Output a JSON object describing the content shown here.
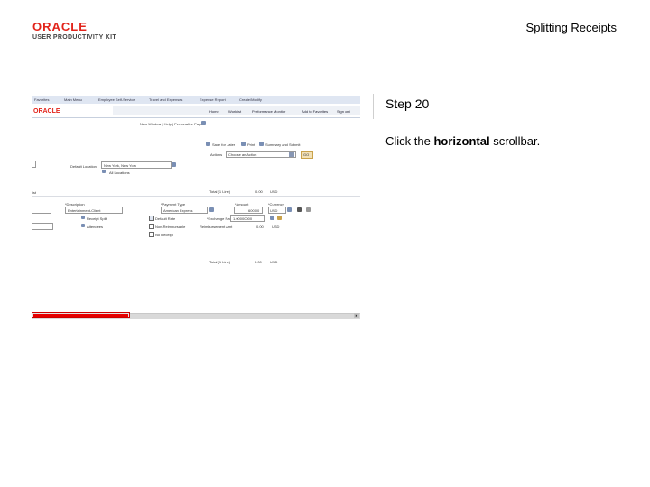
{
  "header": {
    "logo_brand": "ORACLE",
    "logo_product": "USER PRODUCTIVITY KIT",
    "document_title": "Splitting Receipts"
  },
  "instruction_pane": {
    "step": "Step 20",
    "instruction_prefix": "Click the ",
    "instruction_bold": "horizontal",
    "instruction_suffix": " scrollbar."
  },
  "app": {
    "nav": [
      "Favorites",
      "Main Menu",
      "Employee Self-Service",
      "Travel and Expenses",
      "Expense Report",
      "Create/Modify"
    ],
    "brand": "ORACLE",
    "toolbar": [
      "Home",
      "Worklist",
      "Performance Monitor",
      "Add to Favorites",
      "Sign out"
    ],
    "page_links": "New Window | Help | Personalize Page",
    "action_links": [
      "Save for Later",
      "Print",
      "Summary and Submit"
    ],
    "actions_label": "Actions",
    "actions_value": "Choose an Action",
    "go_label": "GO",
    "default_location_label": "Default Location",
    "default_location_value": "New York, New York",
    "all_locations": "All Locations",
    "total_label": "Total (1 Line)",
    "total_value": "0.00",
    "currency": "USD",
    "description_label": "*Description",
    "description_value": "Entertainment-Client",
    "payment_type_label": "*Payment Type",
    "payment_type_value": "American Express",
    "amount_label": "*Amount",
    "amount_value": "600.00",
    "currency_label": "*Currency",
    "currency_value": "USD",
    "receipt_split": "Receipt Split",
    "attendees": "Attendees",
    "default_rate": "Default Rate",
    "non_reimbursable": "Non-Reimbursable",
    "no_receipt": "No Receipt",
    "exchange_rate_label": "*Exchange Rate",
    "exchange_rate_value": "1.00000000",
    "reimbursement_label": "Reimbursement Amt",
    "reimbursement_value": "0.00",
    "total_label_2": "Total (1 Line)",
    "total_value_2": "0.00",
    "currency_2": "USD"
  },
  "colors": {
    "oracle_red": "#e2231a",
    "highlight_red": "#e60000",
    "nav_bg": "#dfe6f2"
  }
}
